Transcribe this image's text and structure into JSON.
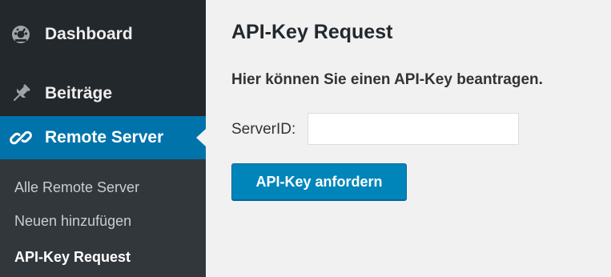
{
  "sidebar": {
    "items": [
      {
        "label": "Dashboard",
        "icon": "dashboard-gauge-icon"
      },
      {
        "label": "Beiträge",
        "icon": "pin-icon"
      },
      {
        "label": "Remote Server",
        "icon": "link-icon",
        "active": true
      }
    ],
    "submenu": [
      {
        "label": "Alle Remote Server"
      },
      {
        "label": "Neuen hinzufügen"
      },
      {
        "label": "API-Key Request",
        "current": true
      }
    ]
  },
  "main": {
    "title": "API-Key Request",
    "description": "Hier können Sie einen API-Key beantragen.",
    "server_field": {
      "label": "ServerID:",
      "value": ""
    },
    "submit_label": "API-Key anfordern"
  },
  "colors": {
    "sidebar_bg": "#23282d",
    "submenu_bg": "#32373c",
    "active_bg": "#0073aa",
    "content_bg": "#f1f1f1",
    "button_bg": "#0085ba"
  }
}
